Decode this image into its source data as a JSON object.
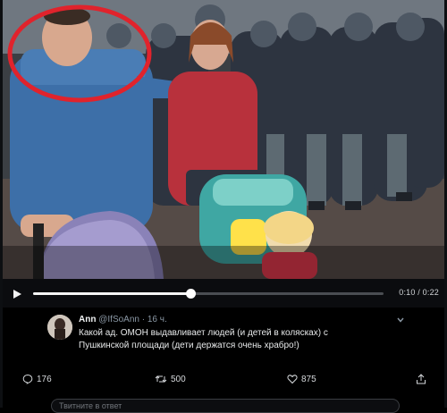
{
  "player": {
    "elapsed": "0:10",
    "total": "0:22",
    "time_display": "0:10 / 0:22",
    "progress_fraction": 0.45
  },
  "tweet": {
    "author_name": "Ann",
    "author_handle": "@IfSoAnn",
    "time_ago": "· 16 ч.",
    "text_line1": "Какой ад. ОМОН выдавливает людей (и детей в колясках) с",
    "text_line2": "Пушкинской площади (дети держатся очень храбро!)"
  },
  "actions": {
    "replies": "176",
    "retweets": "500",
    "likes": "875"
  },
  "reply_box": {
    "placeholder": "Твитните в ответ"
  },
  "colors": {
    "highlight_circle": "#e0232c",
    "progress": "#f5f5f5",
    "background": "#000000"
  },
  "icons": [
    "play-icon",
    "more-icon",
    "reply-icon",
    "retweet-icon",
    "like-icon",
    "share-icon"
  ]
}
